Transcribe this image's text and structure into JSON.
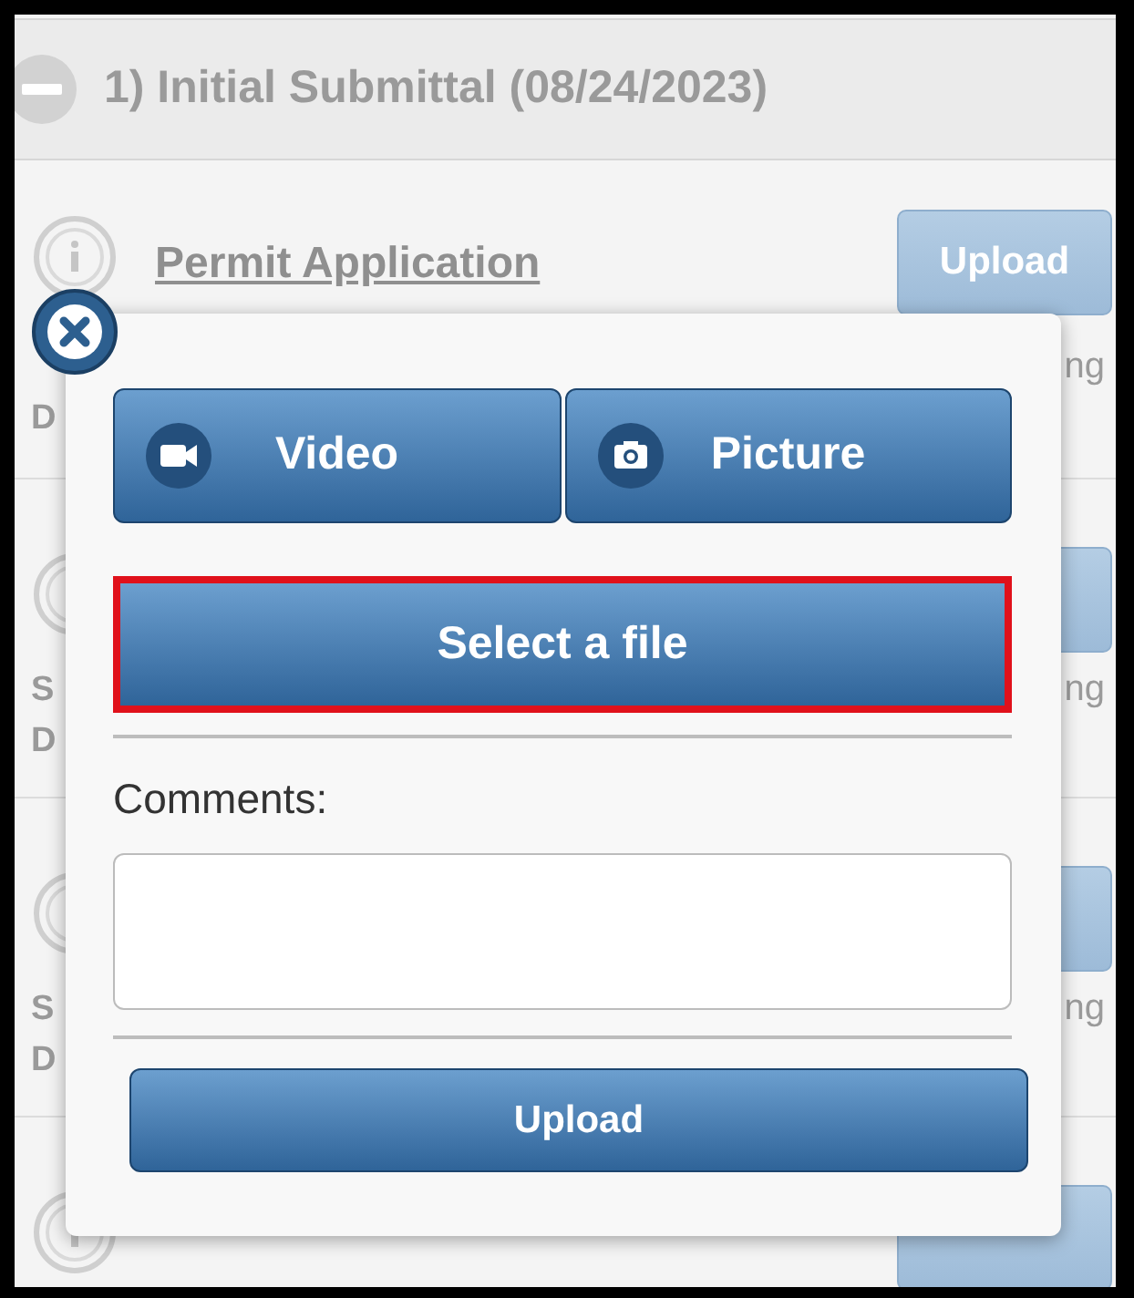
{
  "section": {
    "title": "1) Initial Submittal (08/24/2023)",
    "expanded": true
  },
  "rows": [
    {
      "title": "Permit Application",
      "button_label": "Upload",
      "line_2": "D",
      "side": "ng"
    },
    {
      "line_1": "S",
      "line_2": "D",
      "side": "ng"
    },
    {
      "line_1": "S",
      "line_2": "D",
      "side": "ng"
    },
    {}
  ],
  "dialog": {
    "media_buttons": [
      {
        "kind": "video",
        "label": "Video"
      },
      {
        "kind": "picture",
        "label": "Picture"
      }
    ],
    "select_file": {
      "label": "Select a file",
      "highlighted": true
    },
    "comments": {
      "label": "Comments:"
    },
    "submit": {
      "label": "Upload"
    }
  }
}
